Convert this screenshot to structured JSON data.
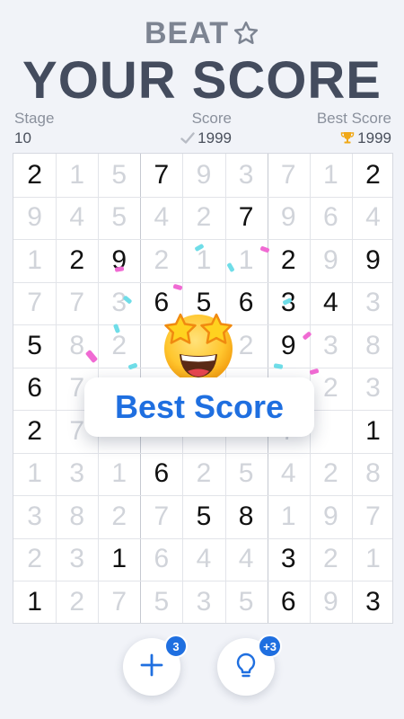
{
  "header": {
    "title_small": "BEAT",
    "title_large": "YOUR SCORE",
    "star_icon": "star-outline-icon"
  },
  "stats": {
    "stage_label": "Stage",
    "stage_value": "10",
    "score_label": "Score",
    "score_value": "1999",
    "score_icon": "check-icon",
    "best_label": "Best Score",
    "best_value": "1999",
    "best_icon": "trophy-icon"
  },
  "board": {
    "columns": 9,
    "rows": [
      [
        [
          "2",
          true
        ],
        [
          "1",
          false
        ],
        [
          "5",
          false
        ],
        [
          "7",
          true
        ],
        [
          "9",
          false
        ],
        [
          "3",
          false
        ],
        [
          "7",
          false
        ],
        [
          "1",
          false
        ],
        [
          "2",
          true
        ]
      ],
      [
        [
          "9",
          false
        ],
        [
          "4",
          false
        ],
        [
          "5",
          false
        ],
        [
          "4",
          false
        ],
        [
          "2",
          false
        ],
        [
          "7",
          true
        ],
        [
          "9",
          false
        ],
        [
          "6",
          false
        ],
        [
          "4",
          false
        ]
      ],
      [
        [
          "1",
          false
        ],
        [
          "2",
          true
        ],
        [
          "9",
          true
        ],
        [
          "2",
          false
        ],
        [
          "1",
          false
        ],
        [
          "1",
          false
        ],
        [
          "2",
          true
        ],
        [
          "9",
          false
        ],
        [
          "9",
          true
        ]
      ],
      [
        [
          "7",
          false
        ],
        [
          "7",
          false
        ],
        [
          "3",
          false
        ],
        [
          "6",
          true
        ],
        [
          "5",
          true
        ],
        [
          "6",
          true
        ],
        [
          "3",
          true
        ],
        [
          "4",
          true
        ],
        [
          "3",
          false
        ]
      ],
      [
        [
          "5",
          true
        ],
        [
          "8",
          false
        ],
        [
          "2",
          false
        ],
        [
          "",
          false
        ],
        [
          "",
          false
        ],
        [
          "2",
          false
        ],
        [
          "9",
          true
        ],
        [
          "3",
          false
        ],
        [
          "8",
          false
        ]
      ],
      [
        [
          "6",
          true
        ],
        [
          "7",
          false
        ],
        [
          "",
          false
        ],
        [
          "",
          false
        ],
        [
          "",
          false
        ],
        [
          "",
          false
        ],
        [
          "",
          false
        ],
        [
          "2",
          false
        ],
        [
          "3",
          false
        ]
      ],
      [
        [
          "2",
          true
        ],
        [
          "7",
          false
        ],
        [
          "",
          false
        ],
        [
          "",
          false
        ],
        [
          "",
          false
        ],
        [
          "",
          false
        ],
        [
          "7",
          false
        ],
        [
          "",
          false
        ],
        [
          "1",
          true
        ]
      ],
      [
        [
          "1",
          false
        ],
        [
          "3",
          false
        ],
        [
          "1",
          false
        ],
        [
          "6",
          true
        ],
        [
          "2",
          false
        ],
        [
          "5",
          false
        ],
        [
          "4",
          false
        ],
        [
          "2",
          false
        ],
        [
          "8",
          false
        ]
      ],
      [
        [
          "3",
          false
        ],
        [
          "8",
          false
        ],
        [
          "2",
          false
        ],
        [
          "7",
          false
        ],
        [
          "5",
          true
        ],
        [
          "8",
          true
        ],
        [
          "1",
          false
        ],
        [
          "9",
          false
        ],
        [
          "7",
          false
        ]
      ],
      [
        [
          "2",
          false
        ],
        [
          "3",
          false
        ],
        [
          "1",
          true
        ],
        [
          "6",
          false
        ],
        [
          "4",
          false
        ],
        [
          "4",
          false
        ],
        [
          "3",
          true
        ],
        [
          "2",
          false
        ],
        [
          "1",
          false
        ]
      ],
      [
        [
          "1",
          true
        ],
        [
          "2",
          false
        ],
        [
          "7",
          false
        ],
        [
          "5",
          false
        ],
        [
          "3",
          false
        ],
        [
          "5",
          false
        ],
        [
          "6",
          true
        ],
        [
          "9",
          false
        ],
        [
          "3",
          true
        ]
      ]
    ]
  },
  "popup": {
    "text": "Best Score",
    "emoji": "star-struck-emoji"
  },
  "tools": {
    "add_badge": "3",
    "hint_badge": "+3",
    "add_icon": "plus-icon",
    "hint_icon": "lightbulb-icon"
  },
  "colors": {
    "accent": "#1f6fe0",
    "background": "#f1f3f8",
    "number_active": "#111111",
    "number_faded": "#d1d4da"
  }
}
